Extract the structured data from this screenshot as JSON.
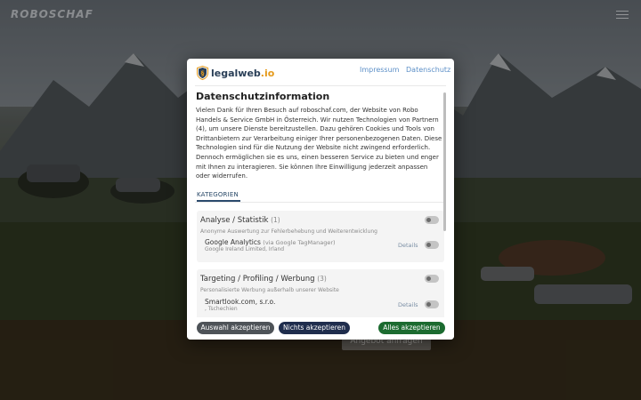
{
  "background": {
    "brand": "ROBOSCHAF",
    "button_label": "Angebot anfragen",
    "icons": [
      "menu-icon"
    ]
  },
  "modal": {
    "logo_text_main": "legalweb",
    "logo_text_suffix": ".io",
    "header_links": [
      "Impressum",
      "Datenschutz"
    ],
    "title": "Datenschutzinformation",
    "intro": "Vielen Dank für Ihren Besuch auf roboschaf.com, der Website von Robo Handels & Service GmbH in Österreich. Wir nutzen Technologien von Partnern (4), um unsere Dienste bereitzustellen. Dazu gehören Cookies und Tools von Drittanbietern zur Verarbeitung einiger Ihrer personenbezogenen Daten. Diese Technologien sind für die Nutzung der Website nicht zwingend erforderlich. Dennoch ermöglichen sie es uns, einen besseren Service zu bieten und enger mit Ihnen zu interagieren. Sie können Ihre Einwilligung jederzeit anpassen oder widerrufen.",
    "tab_label": "KATEGORIEN",
    "categories": [
      {
        "title": "Analyse / Statistik",
        "count": "(1)",
        "description": "Anonyme Auswertung zur Fehlerbehebung und Weiterentwicklung",
        "service_name": "Google Analytics",
        "service_via": "(via Google TagManager)",
        "service_sub": "Google Ireland Limited, Irland",
        "details_label": "Details"
      },
      {
        "title": "Targeting / Profiling / Werbung",
        "count": "(3)",
        "description": "Personalisierte Werbung außerhalb unserer Website",
        "service_name": "Smartlook.com, s.r.o.",
        "service_via": "",
        "service_sub": ", Tschechien",
        "details_label": "Details"
      }
    ],
    "buttons": {
      "select": "Auswahl akzeptieren",
      "none": "Nichts akzeptieren",
      "all": "Alles akzeptieren"
    },
    "colors": {
      "accept_all": "#1c6b30",
      "accept_none": "#1f2d4d",
      "accept_selection": "#4e5358",
      "link": "#5c8fc7",
      "logo_accent": "#e59a1a"
    }
  }
}
